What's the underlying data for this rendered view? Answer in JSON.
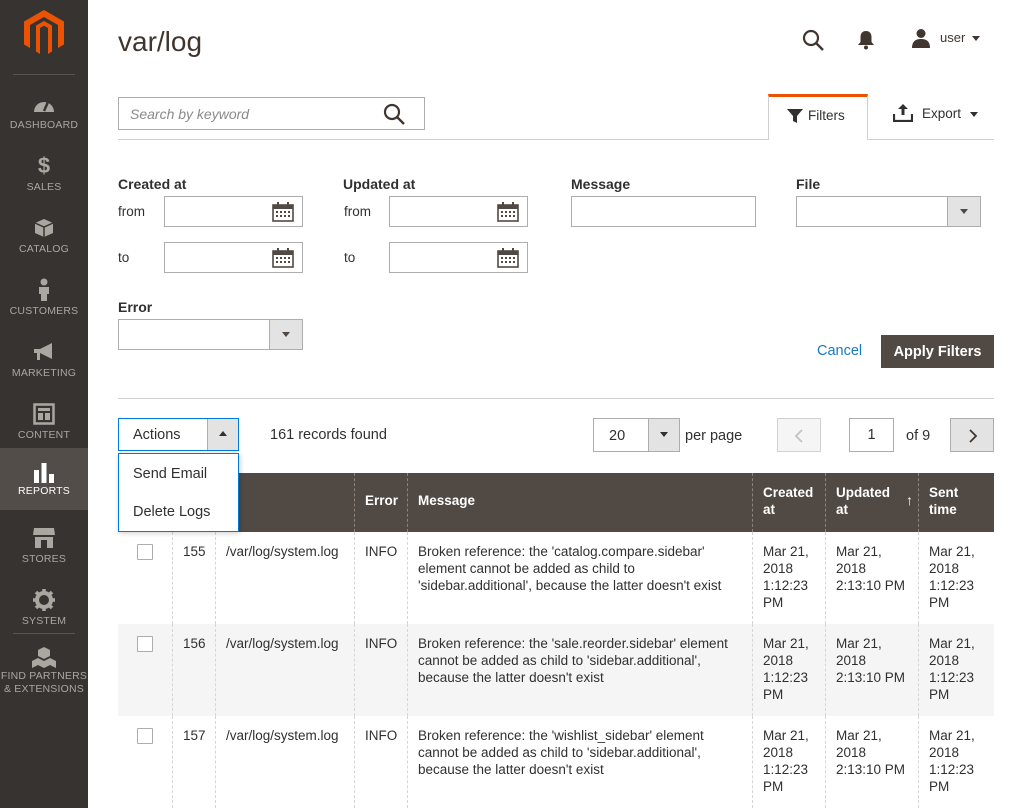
{
  "sidebar": {
    "items": [
      {
        "label": "DASHBOARD",
        "icon": "dashboard-icon"
      },
      {
        "label": "SALES",
        "icon": "dollar-icon"
      },
      {
        "label": "CATALOG",
        "icon": "box-icon"
      },
      {
        "label": "CUSTOMERS",
        "icon": "person-icon"
      },
      {
        "label": "MARKETING",
        "icon": "megaphone-icon"
      },
      {
        "label": "CONTENT",
        "icon": "layout-icon"
      },
      {
        "label": "REPORTS",
        "icon": "bar-chart-icon"
      },
      {
        "label": "STORES",
        "icon": "storefront-icon"
      },
      {
        "label": "SYSTEM",
        "icon": "gear-icon"
      },
      {
        "label1": "FIND PARTNERS",
        "label2": "& EXTENSIONS",
        "icon": "cubes-icon"
      }
    ]
  },
  "header": {
    "title": "var/log",
    "user": "user"
  },
  "search": {
    "placeholder": "Search by keyword"
  },
  "toolbar": {
    "filters_label": "Filters",
    "export_label": "Export"
  },
  "filters": {
    "created_at": "Created at",
    "updated_at": "Updated at",
    "message": "Message",
    "file": "File",
    "error": "Error",
    "from": "from",
    "to": "to",
    "cancel": "Cancel",
    "apply": "Apply Filters"
  },
  "actions": {
    "label": "Actions",
    "menu": [
      "Send Email",
      "Delete Logs"
    ]
  },
  "records": "161 records found",
  "pagination": {
    "per_page_value": "20",
    "per_page_label": "per page",
    "current": "1",
    "of": "of 9"
  },
  "table": {
    "columns": [
      "e",
      "Error",
      "Message",
      "Created at",
      "Updated at",
      "Sent time"
    ],
    "sort_indicator": "↑",
    "rows": [
      {
        "id": "155",
        "file": "/var/log/system.log",
        "error": "INFO",
        "message": "Broken reference: the 'catalog.compare.sidebar' element cannot be added as child to 'sidebar.additional', because the latter doesn't exist",
        "created": "Mar 21, 2018 1:12:23 PM",
        "updated": "Mar 21, 2018 2:13:10 PM",
        "sent": "Mar 21, 2018 1:12:23 PM"
      },
      {
        "id": "156",
        "file": "/var/log/system.log",
        "error": "INFO",
        "message": "Broken reference: the 'sale.reorder.sidebar' element cannot be added as child to 'sidebar.additional', because the latter doesn't exist",
        "created": "Mar 21, 2018 1:12:23 PM",
        "updated": "Mar 21, 2018 2:13:10 PM",
        "sent": "Mar 21, 2018 1:12:23 PM"
      },
      {
        "id": "157",
        "file": "/var/log/system.log",
        "error": "INFO",
        "message": "Broken reference: the 'wishlist_sidebar' element cannot be added as child to 'sidebar.additional', because the latter doesn't exist",
        "created": "Mar 21, 2018 1:12:23 PM",
        "updated": "Mar 21, 2018 2:13:10 PM",
        "sent": "Mar 21, 2018 1:12:23 PM"
      }
    ]
  },
  "colors": {
    "sidebar": "#373330",
    "header_row": "#514943",
    "accent": "#eb5202",
    "link": "#1979c3",
    "active_nav": "#524d49"
  }
}
